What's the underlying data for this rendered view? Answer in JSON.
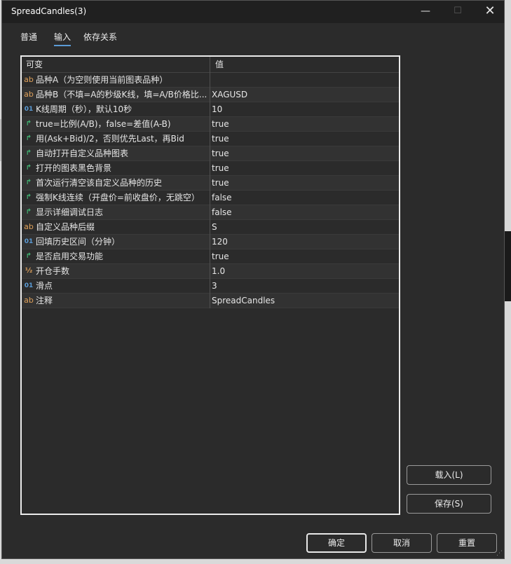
{
  "window": {
    "title": "SpreadCandles(3)"
  },
  "title_controls": {
    "minimize": "—",
    "maximize": "☐",
    "close": "✕"
  },
  "tabs": [
    {
      "label": "普通",
      "active": false
    },
    {
      "label": "输入",
      "active": true
    },
    {
      "label": "依存关系",
      "active": false
    }
  ],
  "table": {
    "columns": [
      "可变",
      "值"
    ],
    "rows": [
      {
        "icon": "string-icon",
        "glyph": "ab",
        "label": "品种A（为空则使用当前图表品种）",
        "value": ""
      },
      {
        "icon": "string-icon",
        "glyph": "ab",
        "label": "品种B（不填=A的秒级K线，填=A/B价格比...",
        "value": "XAGUSD"
      },
      {
        "icon": "integer-icon",
        "glyph": "01",
        "label": "K线周期（秒），默认10秒",
        "value": "10"
      },
      {
        "icon": "bool-icon",
        "glyph": "↱",
        "label": "true=比例(A/B)，false=差值(A-B)",
        "value": "true"
      },
      {
        "icon": "bool-icon",
        "glyph": "↱",
        "label": "用(Ask+Bid)/2，否则优先Last，再Bid",
        "value": "true"
      },
      {
        "icon": "bool-icon",
        "glyph": "↱",
        "label": "自动打开自定义品种图表",
        "value": "true"
      },
      {
        "icon": "bool-icon",
        "glyph": "↱",
        "label": "打开的图表黑色背景",
        "value": "true"
      },
      {
        "icon": "bool-icon",
        "glyph": "↱",
        "label": "首次运行清空该自定义品种的历史",
        "value": "true"
      },
      {
        "icon": "bool-icon",
        "glyph": "↱",
        "label": "强制K线连续（开盘价=前收盘价，无跳空）",
        "value": "false"
      },
      {
        "icon": "bool-icon",
        "glyph": "↱",
        "label": "显示详细调试日志",
        "value": "false"
      },
      {
        "icon": "string-icon",
        "glyph": "ab",
        "label": "自定义品种后缀",
        "value": "S"
      },
      {
        "icon": "integer-icon",
        "glyph": "01",
        "label": "回填历史区间（分钟）",
        "value": "120"
      },
      {
        "icon": "bool-icon",
        "glyph": "↱",
        "label": "是否启用交易功能",
        "value": "true"
      },
      {
        "icon": "double-icon",
        "glyph": "½",
        "label": "开仓手数",
        "value": "1.0"
      },
      {
        "icon": "integer-icon",
        "glyph": "01",
        "label": "滑点",
        "value": "3"
      },
      {
        "icon": "string-icon",
        "glyph": "ab",
        "label": "注释",
        "value": "SpreadCandles"
      }
    ]
  },
  "side_buttons": {
    "load": "载入(L)",
    "save": "保存(S)"
  },
  "footer": {
    "ok": "确定",
    "cancel": "取消",
    "reset": "重置"
  },
  "colors": {
    "accent": "#5b9bd5",
    "bool_icon": "#40b070",
    "string_icon": "#e0a15a",
    "window_bg": "#2b2b2b"
  }
}
